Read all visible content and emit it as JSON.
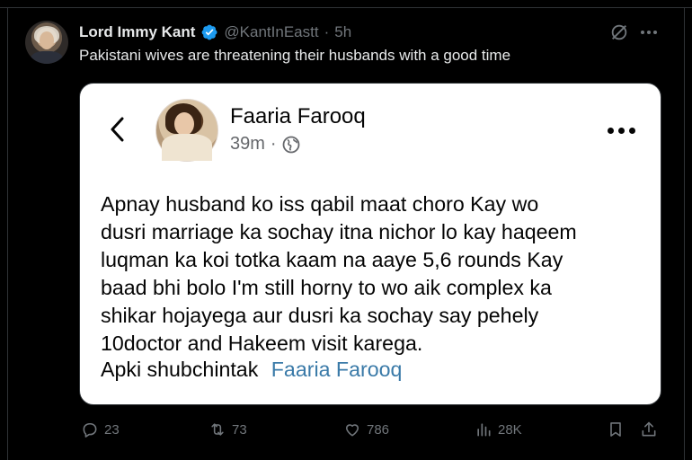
{
  "tweet": {
    "author_name": "Lord Immy Kant",
    "handle": "@KantInEastt",
    "separator": "·",
    "time": "5h",
    "text": "Pakistani wives are threatening their husbands with a good time",
    "icons": [
      "verified-badge-icon",
      "grok-icon",
      "more-icon"
    ]
  },
  "media": {
    "fb_post": {
      "author_name": "Faaria Farooq",
      "time": "39m",
      "separator": "·",
      "body_lines": [
        "Apnay husband ko iss qabil maat choro Kay wo",
        "dusri marriage ka sochay itna nichor lo kay haqeem",
        "luqman ka koi totka kaam na aaye 5,6 rounds Kay",
        "baad bhi bolo I'm still horny to wo aik complex ka",
        "shikar hojayega aur dusri ka sochay say pehely",
        "10doctor and Hakeem visit karega."
      ],
      "signoff_label": "Apki shubchintak",
      "signoff_name": "Faaria Farooq",
      "link_color": "#3a7aa8"
    }
  },
  "actions": {
    "replies": "23",
    "reposts": "73",
    "likes": "786",
    "views": "28K"
  },
  "colors": {
    "background": "#000000",
    "text": "#e7e9ea",
    "muted": "#71767b",
    "verified": "#1d9bf0",
    "border": "#2f3336"
  }
}
